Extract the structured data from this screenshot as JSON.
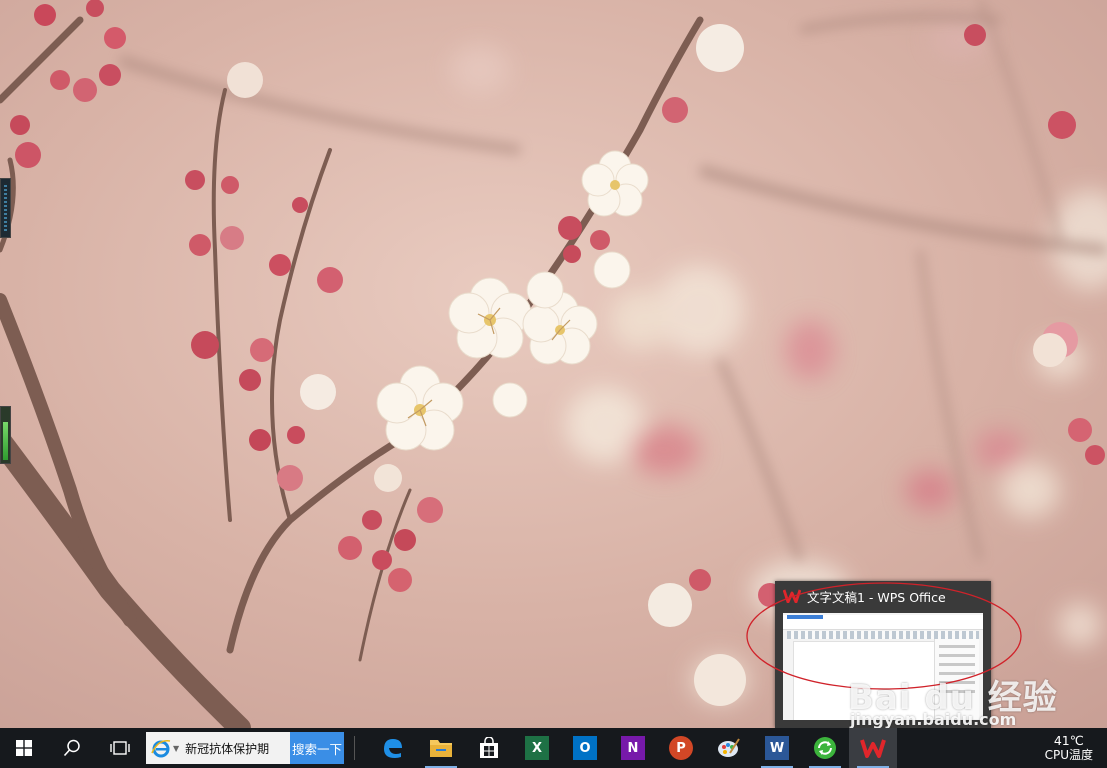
{
  "window_preview": {
    "title": "文字文稿1 - WPS Office",
    "app_icon": "wps-writer-icon"
  },
  "watermark": {
    "text": "Bai du 经验",
    "sub": "jingyan.baidu.com"
  },
  "taskbar": {
    "start_icon": "windows-start-icon",
    "search_icon": "search-icon",
    "task_view_icon": "task-view-icon",
    "browser_search": {
      "engine_icon": "ie-icon",
      "value": "新冠抗体保护期",
      "button_label": "搜索一下"
    },
    "pinned_apps": [
      {
        "name": "edge-icon",
        "running": false
      },
      {
        "name": "file-explorer-icon",
        "running": true
      },
      {
        "name": "store-icon",
        "running": false
      },
      {
        "name": "excel-icon",
        "label": "X",
        "color": "#1e7145",
        "running": false
      },
      {
        "name": "outlook-icon",
        "label": "O",
        "color": "#0072c6",
        "running": false
      },
      {
        "name": "onenote-icon",
        "label": "N",
        "color": "#7719aa",
        "running": false
      },
      {
        "name": "powerpoint-icon",
        "label": "P",
        "color": "#d24726",
        "running": false
      },
      {
        "name": "paint-icon",
        "running": false
      },
      {
        "name": "word-icon",
        "label": "W",
        "color": "#2b5797",
        "running": true
      },
      {
        "name": "update-icon",
        "running": true
      },
      {
        "name": "wps-icon",
        "running": true,
        "active": true
      }
    ],
    "tray": {
      "temperature": "41℃",
      "label": "CPU温度"
    }
  },
  "colors": {
    "taskbar_bg": "#16191d",
    "search_button": "#3a8ee6",
    "annotation_red": "#d0222a",
    "wps_red": "#e0262b"
  }
}
